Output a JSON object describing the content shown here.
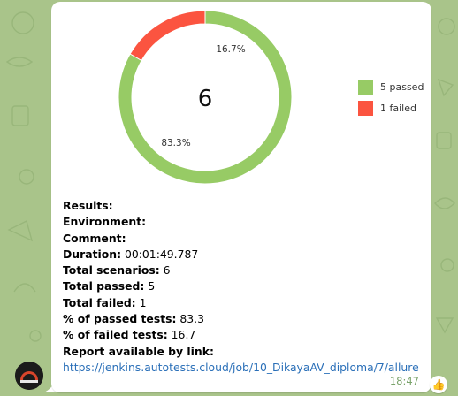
{
  "chart_data": {
    "type": "donut",
    "center_label": "6",
    "slices": [
      {
        "name": "5 passed",
        "value": 5,
        "percent_label": "83.3%",
        "color": "#97cb65"
      },
      {
        "name": "1 failed",
        "value": 1,
        "percent_label": "16.7%",
        "color": "#fb5440"
      }
    ],
    "legend_position": "right"
  },
  "message": {
    "lines": [
      {
        "label": "Results:",
        "value": ""
      },
      {
        "label": "Environment:",
        "value": ""
      },
      {
        "label": "Comment:",
        "value": ""
      },
      {
        "label": "Duration:",
        "value": " 00:01:49.787"
      },
      {
        "label": "Total scenarios:",
        "value": " 6"
      },
      {
        "label": "Total passed:",
        "value": " 5"
      },
      {
        "label": "Total failed:",
        "value": " 1"
      },
      {
        "label": "% of passed tests:",
        "value": " 83.3"
      },
      {
        "label": "% of failed tests:",
        "value": " 16.7"
      },
      {
        "label": "Report available by link:",
        "value": ""
      }
    ],
    "link": "https://jenkins.autotests.cloud/job/10_DikayaAV_diploma/7/allure",
    "time": "18:47"
  },
  "reaction": {
    "icon": "thumbs-up-icon",
    "glyph": "👍"
  },
  "colors": {
    "wallpaper": "#a9c48a",
    "bubble": "#ffffff",
    "link": "#2a6fb8"
  }
}
